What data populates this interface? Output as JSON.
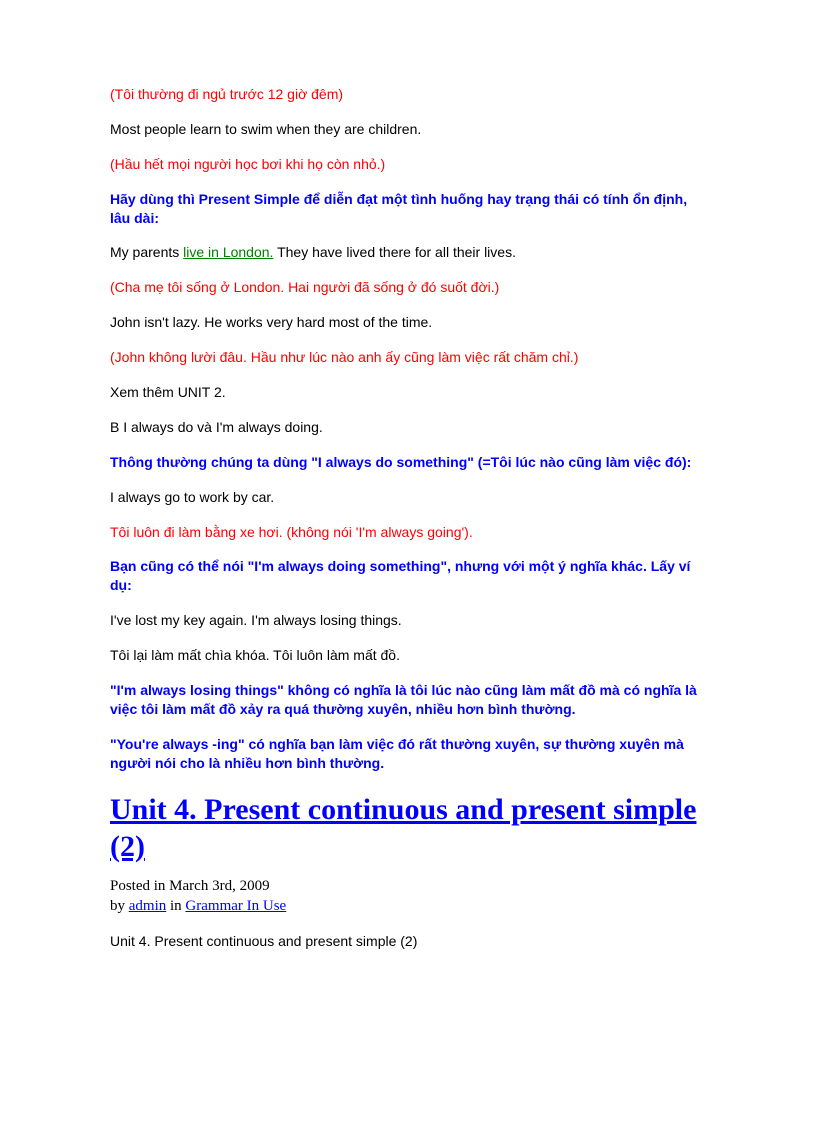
{
  "p1": "(Tôi thường đi ngủ trước 12 giờ đêm)",
  "p2": "Most people learn to swim when they are children.",
  "p3": "(Hầu hết mọi người học bơi khi họ còn nhỏ.)",
  "p4": "Hãy dùng thì Present Simple để diễn đạt một tình huống hay trạng thái có tính ổn định, lâu dài:",
  "p5a": "My parents ",
  "p5link": "live in London.",
  "p5b": " They have lived there for all their lives.",
  "p6": "(Cha mẹ tôi sống ở London. Hai người đã sống ở đó suốt đời.)",
  "p7": "John isn't lazy. He works very hard most of the time.",
  "p8": "(John không lười đâu. Hầu như lúc nào anh ấy cũng làm việc rất chăm chỉ.)",
  "p9": "Xem thêm UNIT 2.",
  "p10": "B I always do và I'm always doing.",
  "p11": "Thông thường chúng ta dùng \"I always do something\" (=Tôi lúc nào cũng làm việc đó):",
  "p12": "I always go to work by car.",
  "p13": "Tôi luôn đi làm bằng xe hơi. (không nói 'I'm always going').",
  "p14": "Bạn cũng có thể nói \"I'm always doing something\", nhưng với một ý nghĩa khác. Lấy ví dụ:",
  "p15": "I've lost my key again. I'm always losing things.",
  "p16": "Tôi lại làm mất chìa khóa. Tôi luôn làm mất đồ.",
  "p17": "\"I'm always losing things\" không có nghĩa là tôi lúc nào cũng làm mất đồ mà có nghĩa là việc tôi làm mất đồ xảy ra quá thường xuyên, nhiều hơn bình thường.",
  "p18": "\"You're always -ing\" có nghĩa bạn làm việc đó rất thường xuyên, sự thường xuyên mà người nói cho là nhiều hơn bình thường.",
  "unitTitle": "Unit 4. Present continuous and present simple (2)",
  "meta": {
    "posted": "Posted in March 3rd, 2009",
    "by": "by ",
    "admin": "admin",
    "in": " in ",
    "category": "Grammar In Use"
  },
  "p19": "Unit 4. Present continuous and present simple (2)"
}
